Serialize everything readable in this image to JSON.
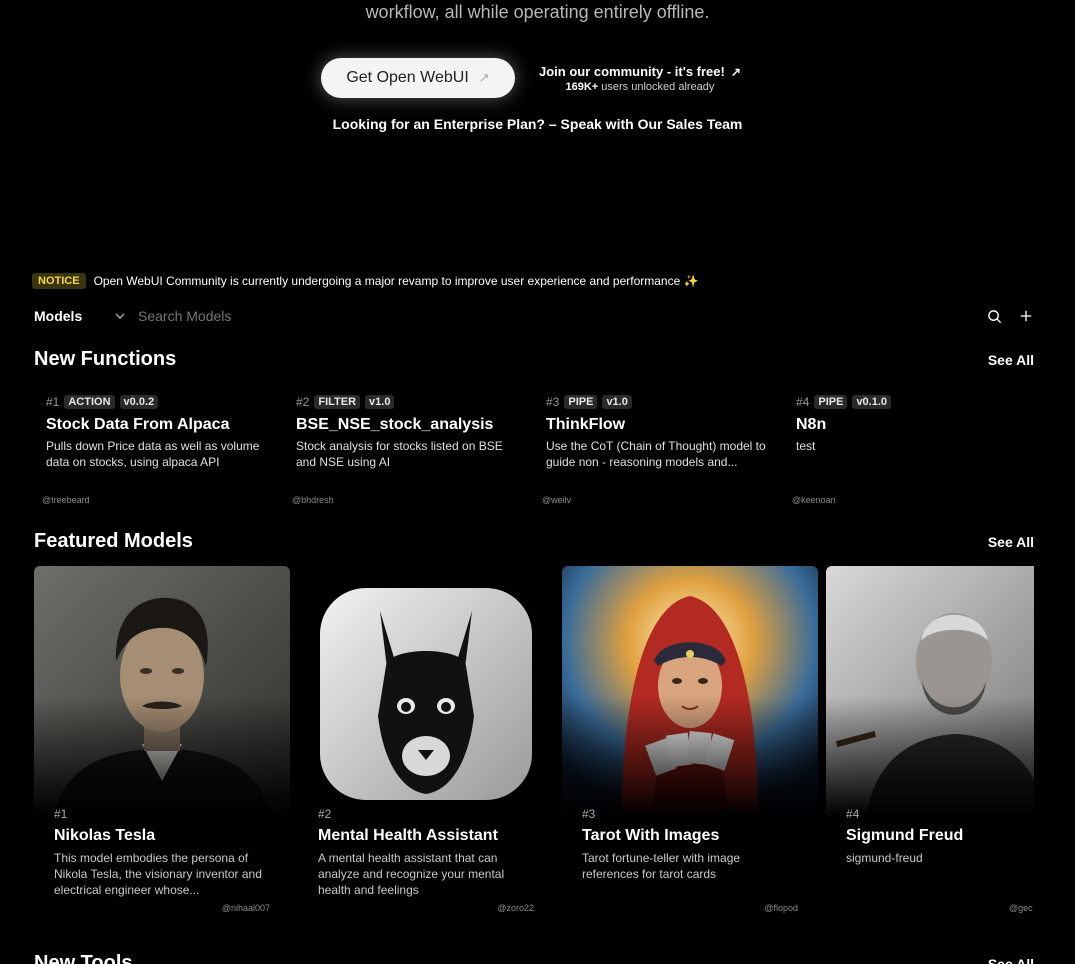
{
  "hero": {
    "subtitle": "workflow, all while operating entirely offline.",
    "get_button": "Get Open WebUI",
    "get_button_icon": "external-arrow-icon",
    "community_title": "Join our community - it's free!",
    "community_count": "169K+",
    "community_suffix": "users unlocked already",
    "enterprise_text": "Looking for an Enterprise Plan? – Speak with Our Sales Team"
  },
  "notice": {
    "badge": "NOTICE",
    "text": "Open WebUI Community is currently undergoing a major revamp to improve user experience and performance ✨"
  },
  "search_bar": {
    "category": "Models",
    "placeholder": "Search Models",
    "icons": [
      "chevron-down-icon",
      "search-icon",
      "plus-icon"
    ]
  },
  "new_functions": {
    "title": "New Functions",
    "see_all": "See All",
    "items": [
      {
        "rank": "#1",
        "type": "ACTION",
        "version": "v0.0.2",
        "name": "Stock Data From Alpaca",
        "description": "Pulls down Price data as well as volume data on stocks, using alpaca API",
        "author": "@treebeard"
      },
      {
        "rank": "#2",
        "type": "FILTER",
        "version": "v1.0",
        "name": "BSE_NSE_stock_analysis",
        "description": "Stock analysis for stocks listed on BSE and NSE using AI",
        "author": "@bhdresh"
      },
      {
        "rank": "#3",
        "type": "PIPE",
        "version": "v1.0",
        "name": "ThinkFlow",
        "description": "Use the CoT (Chain of Thought) model to guide non - reasoning models and...",
        "author": "@weilv"
      },
      {
        "rank": "#4",
        "type": "PIPE",
        "version": "v0.1.0",
        "name": "N8n",
        "description": "test",
        "author": "@keenoan"
      }
    ]
  },
  "featured_models": {
    "title": "Featured Models",
    "see_all": "See All",
    "items": [
      {
        "rank": "#1",
        "name": "Nikolas Tesla",
        "description": "This model embodies the persona of Nikola Tesla, the visionary inventor and electrical engineer whose...",
        "author": "@nihaal007",
        "image": "portrait-photo"
      },
      {
        "rank": "#2",
        "name": "Mental Health Assistant",
        "description": "A mental health assistant that can analyze and recognize your mental health and feelings",
        "author": "@zoro22",
        "image": "llama-logo"
      },
      {
        "rank": "#3",
        "name": "Tarot With Images",
        "description": "Tarot fortune-teller with image references for tarot cards",
        "author": "@flopod",
        "image": "tarot-reader-illustration"
      },
      {
        "rank": "#4",
        "name": "Sigmund Freud",
        "description": "sigmund-freud",
        "author": "@gec",
        "image": "portrait-photo"
      }
    ]
  },
  "new_tools": {
    "title": "New Tools",
    "see_all": "See All"
  },
  "colors": {
    "background": "#000000",
    "notice_badge_bg": "#3a3410",
    "notice_badge_text": "#f4d64a",
    "tag_bg": "#2a2a2a"
  }
}
